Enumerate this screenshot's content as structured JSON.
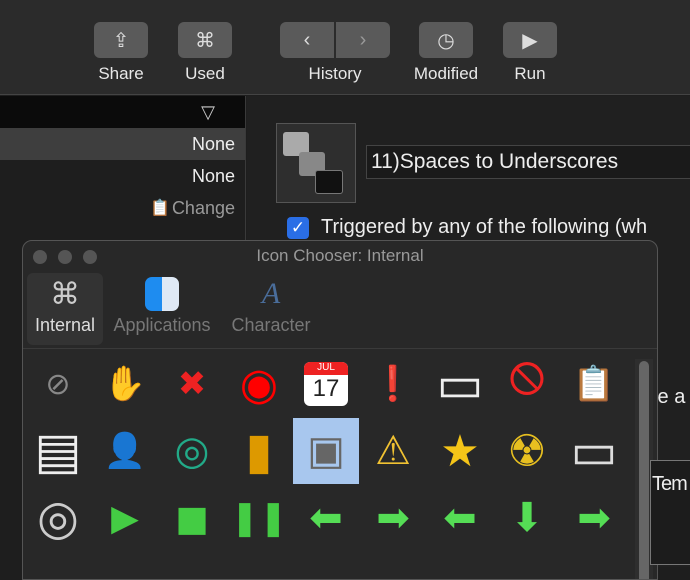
{
  "toolbar": {
    "share": "Share",
    "used": "Used",
    "history": "History",
    "modified": "Modified",
    "run": "Run"
  },
  "sidebar": {
    "header_icon": "▽",
    "rows": [
      "None",
      "None",
      "Change"
    ]
  },
  "macro": {
    "name": "11)Spaces to Underscores",
    "triggered": "Triggered by any of the following (wh",
    "partial_1": "te a",
    "partial_2": "Tem"
  },
  "chooser": {
    "title": "Icon Chooser: Internal",
    "tabs": [
      "Internal",
      "Applications",
      "Character"
    ],
    "icons": [
      [
        "no-sign",
        "stop-hand",
        "red-x",
        "red-target",
        "calendar",
        "red-exclamation",
        "blank-window",
        "prohibited",
        "clipboard-arrow"
      ],
      [
        "list-window",
        "contacts",
        "chrome",
        "drive",
        "macro-group",
        "warning",
        "star",
        "radiation",
        "window-preview"
      ],
      [
        "cd",
        "green-play",
        "green-stop",
        "green-pause",
        "green-left-arrow",
        "green-right-rotate",
        "green-left-rotate",
        "green-down-arrow",
        "green-right-arrow"
      ]
    ],
    "calendar": {
      "month": "JUL",
      "day": "17"
    },
    "selected": "macro-group"
  }
}
